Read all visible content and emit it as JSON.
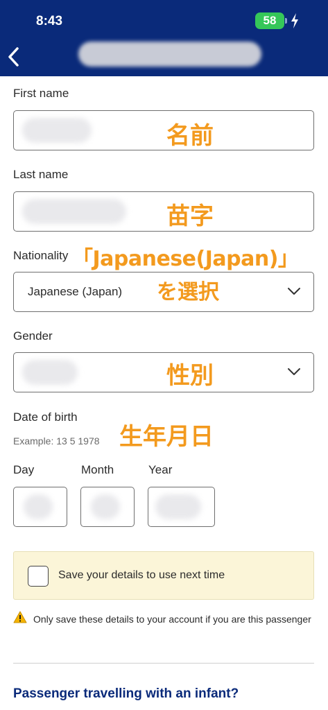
{
  "status_bar": {
    "time": "8:43",
    "battery": "58"
  },
  "header": {
    "back_icon": "chevron-left-icon"
  },
  "form": {
    "first_name_label": "First name",
    "last_name_label": "Last name",
    "nationality_label": "Nationality",
    "nationality_value": "Japanese (Japan)",
    "gender_label": "Gender",
    "dob_label": "Date of birth",
    "dob_hint": "Example: 13 5 1978",
    "day_label": "Day",
    "month_label": "Month",
    "year_label": "Year"
  },
  "annotations": {
    "first_name": "名前",
    "last_name": "苗字",
    "nationality_line1": "「Japanese(Japan)」",
    "nationality_line2": "を選択",
    "gender": "性別",
    "dob": "生年月日"
  },
  "save_details": {
    "label": "Save your details to use next time"
  },
  "warning": {
    "text": "Only save these details to your account if you are this passenger"
  },
  "section": {
    "title": "Passenger travelling with an infant?"
  },
  "colors": {
    "header_bg": "#0a2a7a",
    "accent_orange": "#f39a1e",
    "battery_green": "#35c759",
    "panel_bg": "#fbf5d8"
  }
}
